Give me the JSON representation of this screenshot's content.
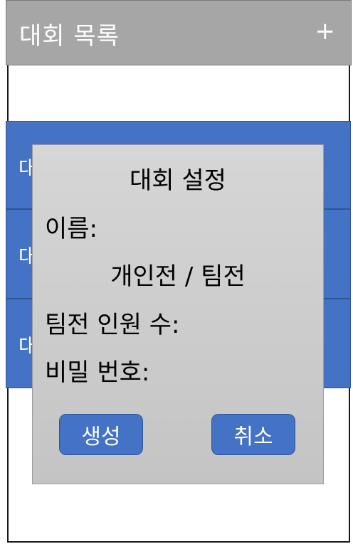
{
  "header": {
    "title": "대회 목록",
    "add_icon": "plus-icon",
    "add_glyph": "+"
  },
  "list": {
    "items": [
      {
        "label": "대회 1"
      },
      {
        "label": "대회 2"
      },
      {
        "label": "대회 3"
      }
    ]
  },
  "dialog": {
    "title": "대회 설정",
    "name_label": "이름:",
    "mode_toggle": "개인전 / 팀전",
    "team_size_label": "팀전 인원 수:",
    "password_label": "비밀 번호:",
    "create_label": "생성",
    "cancel_label": "취소"
  },
  "colors": {
    "header_bg": "#a6a6a6",
    "accent": "#4472c4",
    "dialog_bg": "#c8c8c8"
  }
}
